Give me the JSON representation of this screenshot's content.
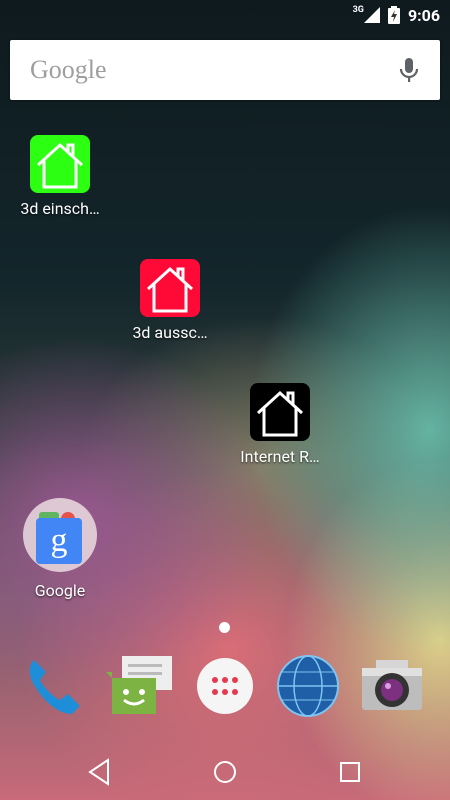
{
  "status_bar": {
    "network_label": "3G",
    "time": "9:06"
  },
  "search": {
    "logo_text": "Google"
  },
  "desktop_apps": [
    {
      "label": "3d einsch…",
      "color": "#2cff12",
      "icon": "house-icon"
    },
    {
      "label": "3d aussc…",
      "color": "#ff0a37",
      "icon": "house-icon"
    },
    {
      "label": "Internet R…",
      "color": "#000000",
      "icon": "house-icon"
    }
  ],
  "folder": {
    "label": "Google",
    "icon": "google-g-icon"
  },
  "dock": [
    {
      "name": "phone",
      "icon": "phone-icon"
    },
    {
      "name": "messaging",
      "icon": "message-icon"
    },
    {
      "name": "all-apps",
      "icon": "app-drawer-icon"
    },
    {
      "name": "browser",
      "icon": "globe-icon"
    },
    {
      "name": "camera",
      "icon": "camera-icon"
    }
  ],
  "nav": [
    "back",
    "home",
    "recents"
  ]
}
